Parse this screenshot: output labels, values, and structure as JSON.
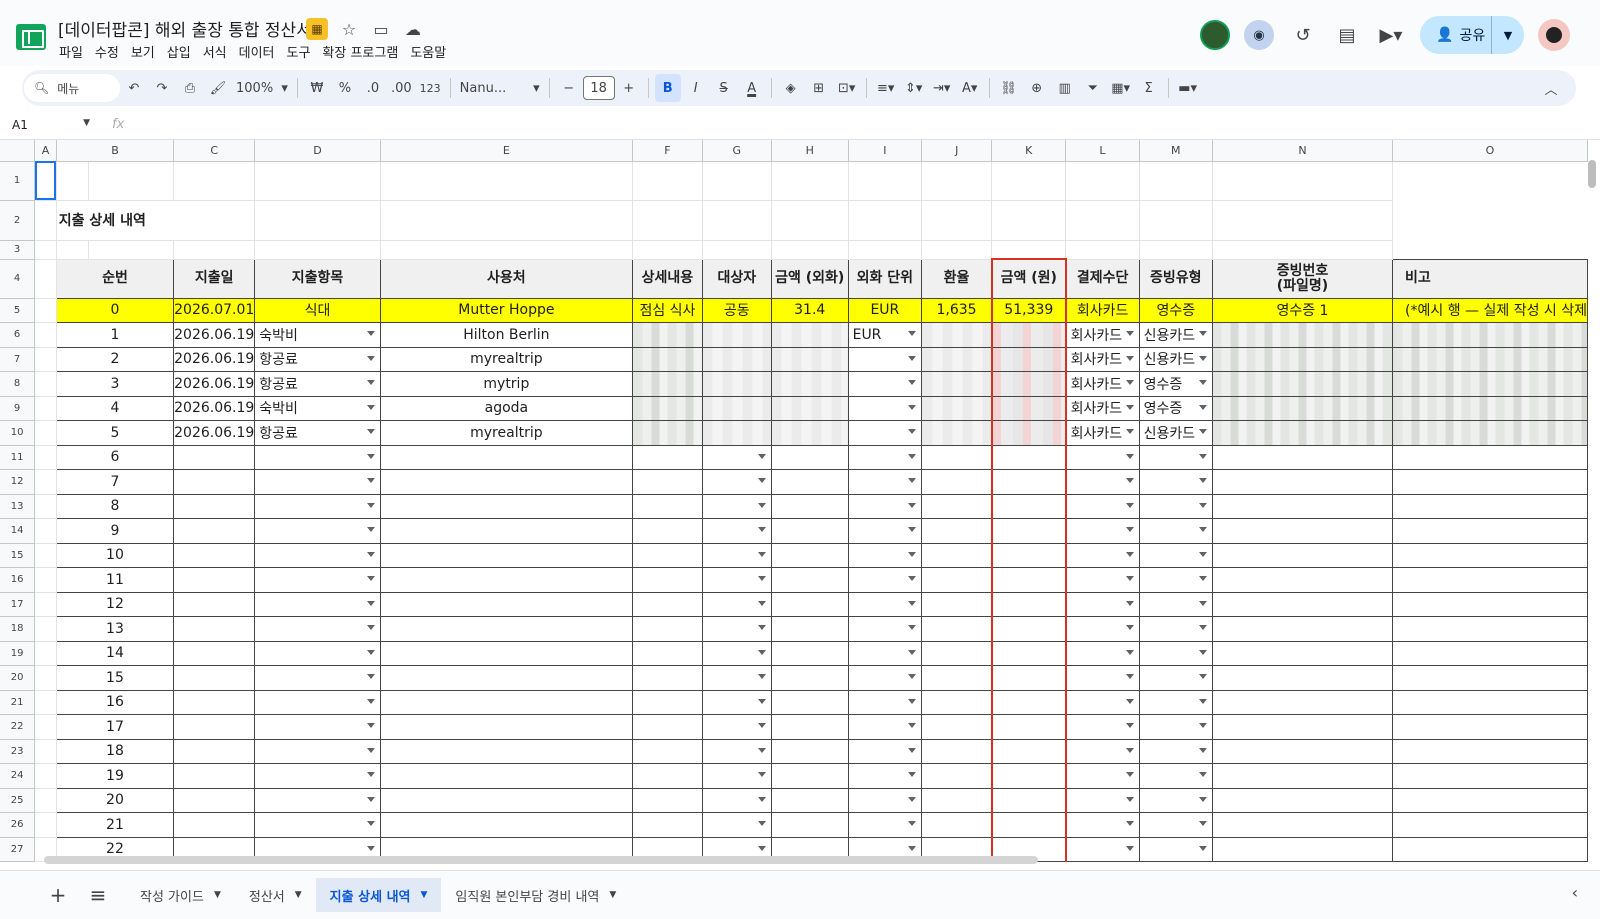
{
  "doc_title": "[데이터팝콘] 해외 출장 통합 정산서",
  "menu": [
    "파일",
    "수정",
    "보기",
    "삽입",
    "서식",
    "데이터",
    "도구",
    "확장 프로그램",
    "도움말"
  ],
  "share_label": "공유",
  "toolbar": {
    "search_label": "메뉴",
    "zoom": "100%",
    "currency": "₩",
    "percent": "%",
    "dec_less": ".0",
    "dec_more": ".00",
    "number_format": "123",
    "font": "Nanu...",
    "font_size": "18",
    "bold": "B",
    "italic": "I",
    "strike": "S",
    "text_color": "A",
    "sum": "Σ"
  },
  "namebox": "A1",
  "fx": "fx",
  "columns": [
    "A",
    "B",
    "C",
    "D",
    "E",
    "F",
    "G",
    "H",
    "I",
    "J",
    "K",
    "L",
    "M",
    "N",
    "O"
  ],
  "rows": [
    "1",
    "2",
    "3",
    "4",
    "5",
    "6",
    "7",
    "8",
    "9",
    "10",
    "11",
    "12",
    "13",
    "14",
    "15",
    "16",
    "17",
    "18",
    "19",
    "20",
    "21",
    "22",
    "23",
    "24",
    "25",
    "26",
    "27"
  ],
  "sheet_title": "지출 상세 내역",
  "headers": {
    "b": "순번",
    "c": "지출일",
    "d": "지출항목",
    "e": "사용처",
    "f": "상세내용",
    "g": "대상자",
    "h": "금액 (외화)",
    "i": "외화 단위",
    "j": "환율",
    "k": "금액 (원)",
    "l": "결제수단",
    "m": "증빙유형",
    "n1": "증빙번호",
    "n2": "(파일명)",
    "o": "비고"
  },
  "example_row": {
    "no": "0",
    "date": "2026.07.01",
    "category": "식대",
    "vendor": "Mutter Hoppe",
    "detail": "점심 식사",
    "target": "공동",
    "amount_fx": "31.4",
    "currency": "EUR",
    "rate": "1,635",
    "amount_krw": "51,339",
    "payment": "회사카드",
    "proof": "영수증",
    "proof_no": "영수증 1",
    "note": "(*예시 행 — 실제 작성 시 삭제"
  },
  "data_rows": [
    {
      "no": "1",
      "date": "2026.06.19",
      "category": "숙박비",
      "vendor": "Hilton Berlin",
      "currency": "EUR",
      "payment": "회사카드",
      "proof": "신용카드"
    },
    {
      "no": "2",
      "date": "2026.06.19",
      "category": "항공료",
      "vendor": "myrealtrip",
      "currency": "",
      "payment": "회사카드",
      "proof": "신용카드"
    },
    {
      "no": "3",
      "date": "2026.06.19",
      "category": "항공료",
      "vendor": "mytrip",
      "currency": "",
      "payment": "회사카드",
      "proof": "영수증"
    },
    {
      "no": "4",
      "date": "2026.06.19",
      "category": "숙박비",
      "vendor": "agoda",
      "currency": "",
      "payment": "회사카드",
      "proof": "영수증"
    },
    {
      "no": "5",
      "date": "2026.06.19",
      "category": "항공료",
      "vendor": "myrealtrip",
      "currency": "",
      "payment": "회사카드",
      "proof": "신용카드"
    }
  ],
  "empty_numbers": [
    "6",
    "7",
    "8",
    "9",
    "10",
    "11",
    "12",
    "13",
    "14",
    "15",
    "16",
    "17",
    "18",
    "19",
    "20",
    "21",
    "22"
  ],
  "sheet_tabs": [
    "작성 가이드",
    "정산서",
    "지출 상세 내역",
    "임직원 본인부담 경비 내역"
  ],
  "active_tab": "지출 상세 내역"
}
